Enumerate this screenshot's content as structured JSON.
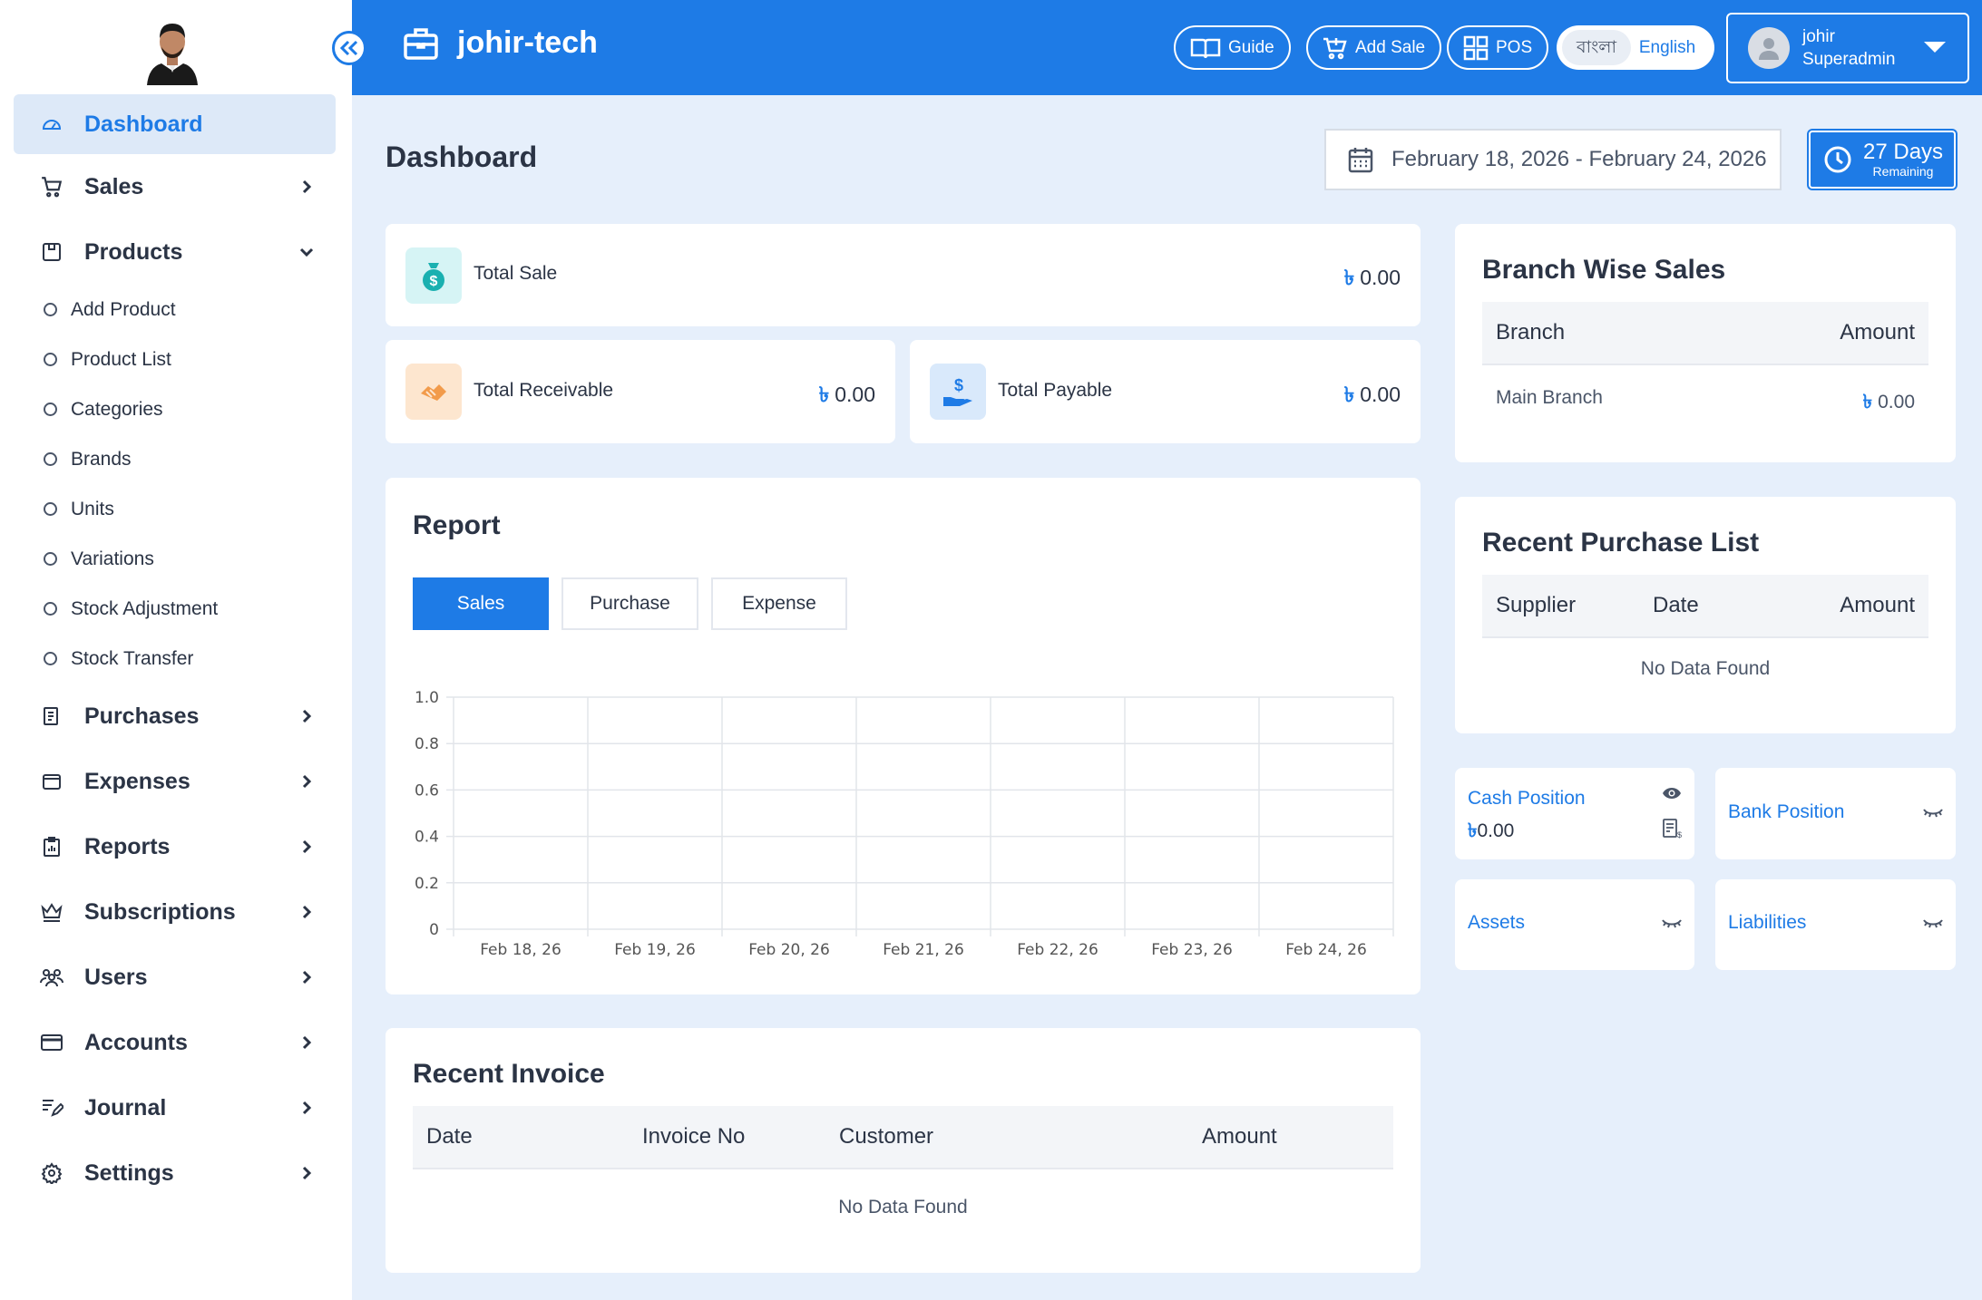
{
  "sidebar": {
    "items": [
      {
        "label": "Dashboard"
      },
      {
        "label": "Sales"
      },
      {
        "label": "Products"
      },
      {
        "label": "Purchases"
      },
      {
        "label": "Expenses"
      },
      {
        "label": "Reports"
      },
      {
        "label": "Subscriptions"
      },
      {
        "label": "Users"
      },
      {
        "label": "Accounts"
      },
      {
        "label": "Journal"
      },
      {
        "label": "Settings"
      }
    ],
    "products_sub": [
      "Add Product",
      "Product List",
      "Categories",
      "Brands",
      "Units",
      "Variations",
      "Stock Adjustment",
      "Stock Transfer"
    ]
  },
  "header": {
    "brand": "johir-tech",
    "guide": "Guide",
    "add_sale": "Add Sale",
    "pos": "POS",
    "lang_bn": "বাংলা",
    "lang_en": "English",
    "user_name": "johir",
    "user_role": "Superadmin"
  },
  "main": {
    "title": "Dashboard",
    "date_range": "February 18, 2026 - February 24, 2026",
    "days_big": "27 Days",
    "days_small": "Remaining",
    "currency": "৳",
    "total_sale_label": "Total Sale",
    "total_sale_value": "0.00",
    "total_receivable_label": "Total Receivable",
    "total_receivable_value": "0.00",
    "total_payable_label": "Total Payable",
    "total_payable_value": "0.00"
  },
  "report": {
    "title": "Report",
    "tabs": [
      "Sales",
      "Purchase",
      "Expense"
    ]
  },
  "chart_data": {
    "type": "line",
    "categories": [
      "Feb 18, 26",
      "Feb 19, 26",
      "Feb 20, 26",
      "Feb 21, 26",
      "Feb 22, 26",
      "Feb 23, 26",
      "Feb 24, 26"
    ],
    "y_ticks": [
      "1.0",
      "0.8",
      "0.6",
      "0.4",
      "0.2",
      "0"
    ],
    "ylim": [
      0,
      1
    ],
    "series": [],
    "grid": true
  },
  "recent_invoice": {
    "title": "Recent Invoice",
    "columns": [
      "Date",
      "Invoice No",
      "Customer",
      "Amount"
    ],
    "empty": "No Data Found"
  },
  "branch_sales": {
    "title": "Branch Wise Sales",
    "columns": [
      "Branch",
      "Amount"
    ],
    "rows": [
      {
        "branch": "Main Branch",
        "amount": "0.00"
      }
    ]
  },
  "recent_purchase": {
    "title": "Recent Purchase List",
    "columns": [
      "Supplier",
      "Date",
      "Amount"
    ],
    "empty": "No Data Found"
  },
  "positions": {
    "cash_label": "Cash Position",
    "cash_value": "0.00",
    "bank_label": "Bank Position",
    "assets_label": "Assets",
    "liabilities_label": "Liabilities"
  },
  "colors": {
    "accent": "#1e7be6",
    "bg": "#e6effb"
  }
}
